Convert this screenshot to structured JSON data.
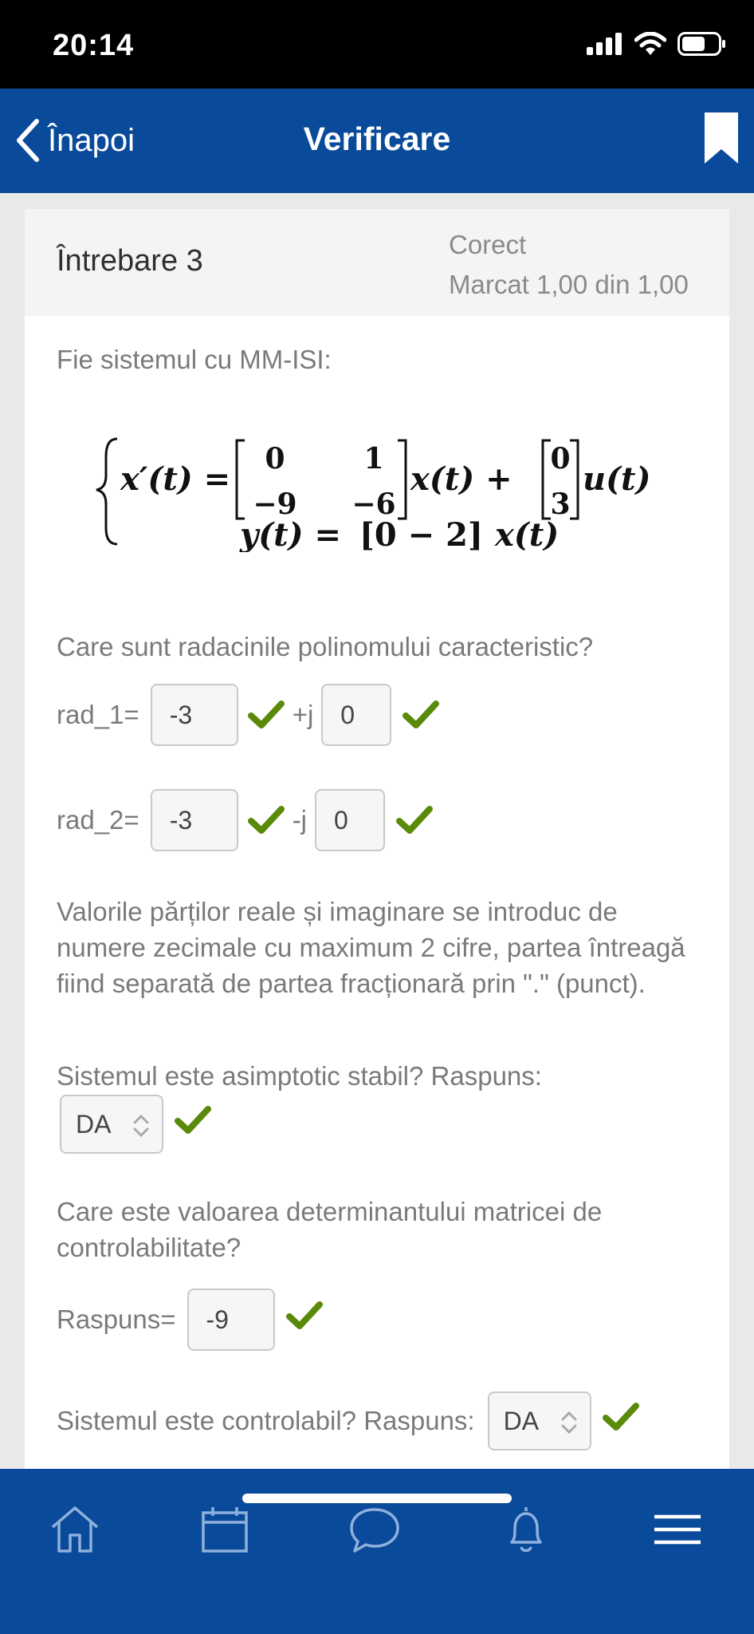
{
  "status_bar": {
    "time": "20:14"
  },
  "nav": {
    "back_label": "Înapoi",
    "title": "Verificare"
  },
  "question": {
    "title": "Întrebare 3",
    "status": "Corect",
    "mark": "Marcat 1,00 din 1,00",
    "intro": "Fie sistemul cu MM-ISI:",
    "formula": {
      "eq1_lhs": "x′(t) =",
      "matrix_A": [
        [
          "0",
          "1"
        ],
        [
          "−9",
          "−6"
        ]
      ],
      "eq1_mid": "x(t) +",
      "matrix_B": [
        "0",
        "3"
      ],
      "eq1_rhs": "u(t)",
      "eq2_lhs": "y(t) =",
      "matrix_C": "[0  − 2]",
      "eq2_rhs": "x(t)"
    },
    "prompt_roots": "Care sunt radacinile polinomului caracteristic?",
    "rad1": {
      "label": "rad_1=",
      "real": "-3",
      "sep": "+j",
      "imag": "0"
    },
    "rad2": {
      "label": "rad_2=",
      "real": "-3",
      "sep": "-j",
      "imag": "0"
    },
    "note": "Valorile părților reale și imaginare se introduc de numere zecimale cu maximum 2 cifre, partea întreagă fiind separată de partea fracționară prin \".\" (punct).",
    "stable_prompt": "Sistemul este asimptotic stabil? Raspuns:",
    "stable_value": "DA",
    "det_prompt": "Care este valoarea determinantului matricei de controlabilitate?",
    "det_label": "Raspuns=",
    "det_value": "-9",
    "ctrl_prompt": "Sistemul este controlabil? Raspuns:",
    "ctrl_value": "DA"
  },
  "icons": {
    "tabs": [
      "home-icon",
      "calendar-icon",
      "chat-icon",
      "bell-icon",
      "menu-icon"
    ]
  },
  "colors": {
    "brand": "#0a4a9a",
    "check": "#5a8a0a"
  }
}
